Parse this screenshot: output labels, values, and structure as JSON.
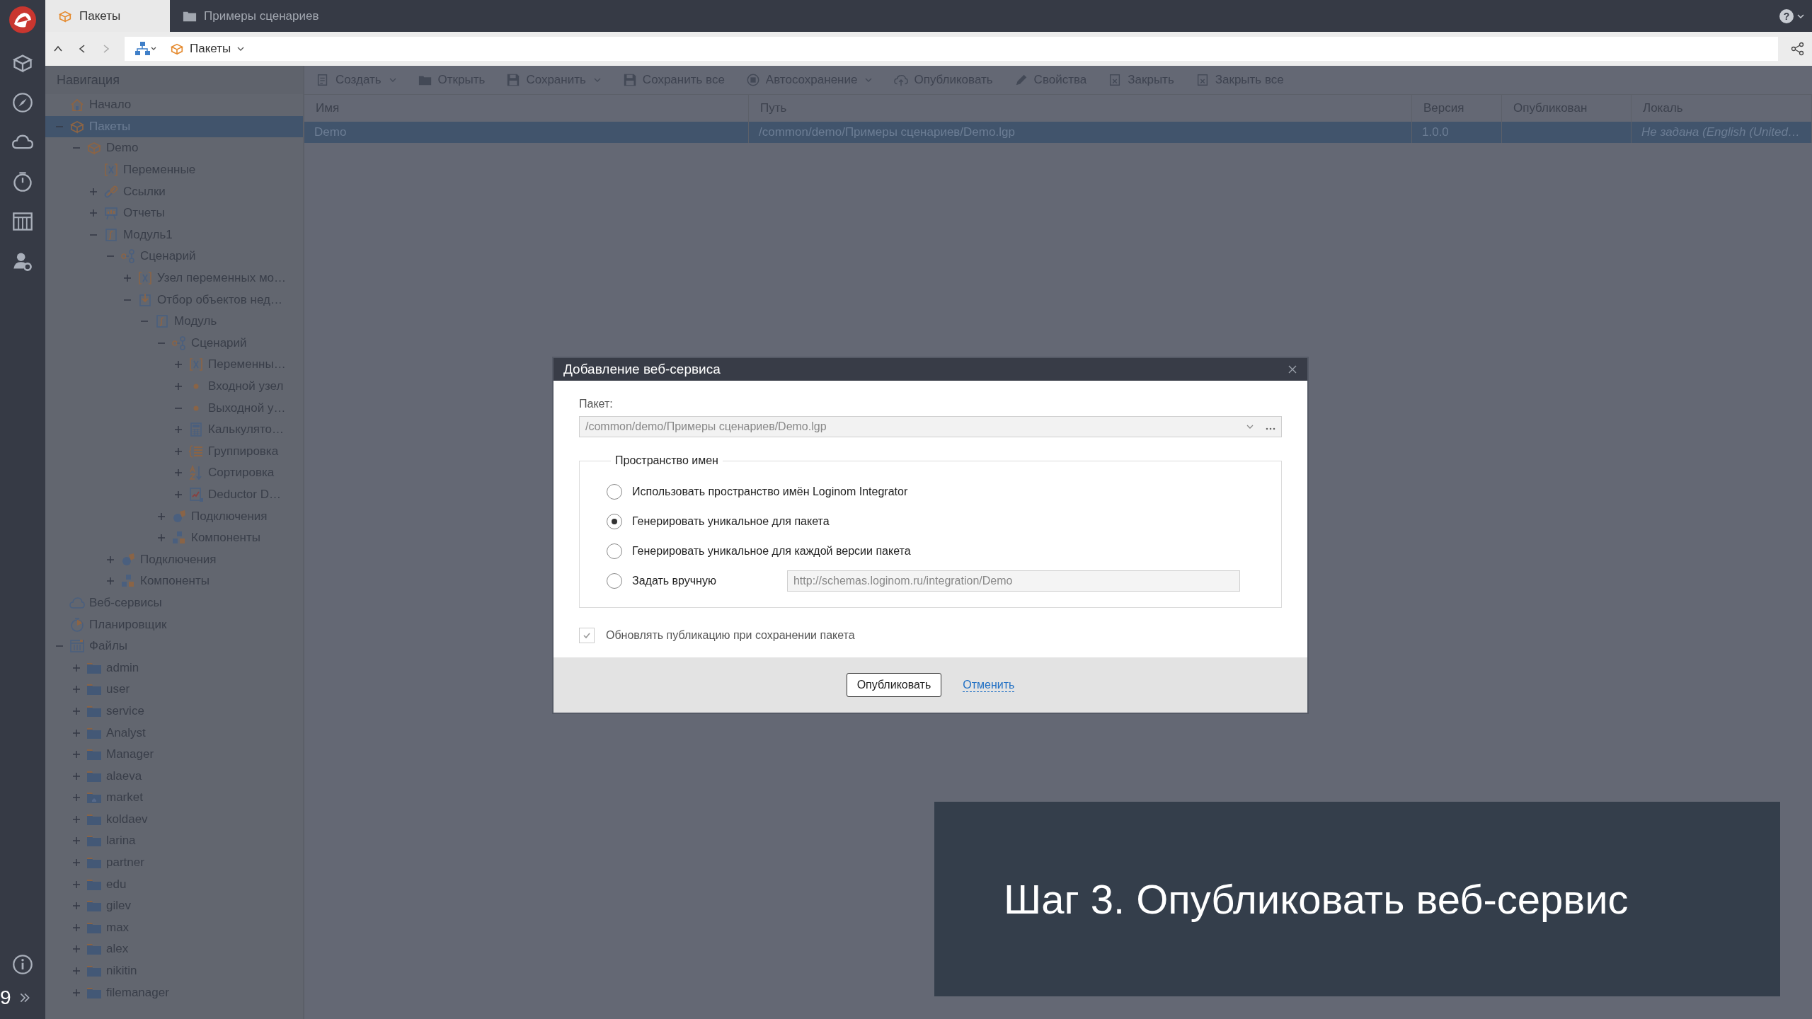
{
  "app_bar": {
    "page_number": "9",
    "help_label": "?"
  },
  "tabs": [
    {
      "label": "Пакеты",
      "kind": "package",
      "selected": true
    },
    {
      "label": "Примеры сценариев",
      "kind": "folder",
      "selected": false
    }
  ],
  "address_bar": {
    "crumb": "Пакеты"
  },
  "navigation": {
    "title": "Навигация",
    "tree": [
      {
        "label": "Начало",
        "kind": "home",
        "selected": false
      },
      {
        "label": "Пакеты",
        "kind": "package",
        "selected": true,
        "expanded": true,
        "children": [
          {
            "label": "Demo",
            "kind": "package",
            "selected": false,
            "expanded": true,
            "children": [
              {
                "label": "Переменные",
                "kind": "variables",
                "selected": false
              },
              {
                "label": "Ссылки",
                "kind": "link",
                "selected": false,
                "expanded": false
              },
              {
                "label": "Отчеты",
                "kind": "report",
                "selected": false,
                "expanded": false
              },
              {
                "label": "Модуль1",
                "kind": "module",
                "selected": false,
                "expanded": true,
                "children": [
                  {
                    "label": "Сценарий",
                    "kind": "scenario",
                    "selected": false,
                    "expanded": true,
                    "children": [
                      {
                        "label": "Узел переменных мо…",
                        "kind": "variables",
                        "selected": false,
                        "expanded": false
                      },
                      {
                        "label": "Отбор объектов нед…",
                        "kind": "import",
                        "selected": false,
                        "expanded": true,
                        "children": [
                          {
                            "label": "Модуль",
                            "kind": "module",
                            "selected": false,
                            "expanded": true,
                            "children": [
                              {
                                "label": "Сценарий",
                                "kind": "scenario",
                                "selected": false,
                                "expanded": true,
                                "children": [
                                  {
                                    "label": "Переменны…",
                                    "kind": "variables",
                                    "selected": false,
                                    "expanded": false
                                  },
                                  {
                                    "label": "Входной узел",
                                    "kind": "dot",
                                    "selected": false,
                                    "expanded": false
                                  },
                                  {
                                    "label": "Выходной у…",
                                    "kind": "dot",
                                    "selected": false,
                                    "expanded": true
                                  },
                                  {
                                    "label": "Калькулято…",
                                    "kind": "calc",
                                    "selected": false,
                                    "expanded": false
                                  },
                                  {
                                    "label": "Группировка",
                                    "kind": "group",
                                    "selected": false,
                                    "expanded": false
                                  },
                                  {
                                    "label": "Сортировка",
                                    "kind": "sort",
                                    "selected": false,
                                    "expanded": false
                                  },
                                  {
                                    "label": "Deductor D…",
                                    "kind": "deductor",
                                    "selected": false,
                                    "expanded": false
                                  }
                                ]
                              },
                              {
                                "label": "Подключения",
                                "kind": "connection",
                                "selected": false,
                                "expanded": false
                              },
                              {
                                "label": "Компоненты",
                                "kind": "components",
                                "selected": false,
                                "expanded": false
                              }
                            ]
                          }
                        ]
                      }
                    ]
                  },
                  {
                    "label": "Подключения",
                    "kind": "connection",
                    "selected": false,
                    "expanded": false
                  },
                  {
                    "label": "Компоненты",
                    "kind": "components",
                    "selected": false,
                    "expanded": false
                  }
                ]
              }
            ]
          }
        ]
      },
      {
        "label": "Веб-сервисы",
        "kind": "cloud",
        "selected": false
      },
      {
        "label": "Планировщик",
        "kind": "timer",
        "selected": false
      },
      {
        "label": "Файлы",
        "kind": "files",
        "selected": false,
        "expanded": true,
        "children": [
          {
            "label": "admin",
            "kind": "folder",
            "selected": false,
            "expanded": false
          },
          {
            "label": "user",
            "kind": "folder",
            "selected": false,
            "expanded": false
          },
          {
            "label": "service",
            "kind": "folder",
            "selected": false,
            "expanded": false
          },
          {
            "label": "Analyst",
            "kind": "folder",
            "selected": false,
            "expanded": false
          },
          {
            "label": "Manager",
            "kind": "folder",
            "selected": false,
            "expanded": false
          },
          {
            "label": "alaeva",
            "kind": "folder",
            "selected": false,
            "expanded": false
          },
          {
            "label": "market",
            "kind": "home-folder",
            "selected": false,
            "expanded": false
          },
          {
            "label": "koldaev",
            "kind": "folder",
            "selected": false,
            "expanded": false
          },
          {
            "label": "larina",
            "kind": "folder",
            "selected": false,
            "expanded": false
          },
          {
            "label": "partner",
            "kind": "folder",
            "selected": false,
            "expanded": false
          },
          {
            "label": "edu",
            "kind": "folder",
            "selected": false,
            "expanded": false
          },
          {
            "label": "gilev",
            "kind": "folder",
            "selected": false,
            "expanded": false
          },
          {
            "label": "max",
            "kind": "folder",
            "selected": false,
            "expanded": false
          },
          {
            "label": "alex",
            "kind": "folder",
            "selected": false,
            "expanded": false
          },
          {
            "label": "nikitin",
            "kind": "folder",
            "selected": false,
            "expanded": false
          },
          {
            "label": "filemanager",
            "kind": "folder",
            "selected": false,
            "expanded": false
          }
        ]
      }
    ]
  },
  "toolbar": [
    {
      "label": "Создать",
      "kind": "create",
      "dropdown": true
    },
    {
      "label": "Открыть",
      "kind": "open",
      "dropdown": false
    },
    {
      "label": "Сохранить",
      "kind": "save",
      "dropdown": true
    },
    {
      "label": "Сохранить все",
      "kind": "save",
      "dropdown": false
    },
    {
      "label": "Автосохранение",
      "kind": "autosave",
      "dropdown": true
    },
    {
      "label": "Опубликовать",
      "kind": "publish",
      "dropdown": false
    },
    {
      "label": "Свойства",
      "kind": "edit",
      "dropdown": false
    },
    {
      "label": "Закрыть",
      "kind": "close",
      "dropdown": false
    },
    {
      "label": "Закрыть все",
      "kind": "close",
      "dropdown": false
    }
  ],
  "table": {
    "columns": [
      "Имя",
      "Путь",
      "Версия",
      "Опубликован",
      "Локаль"
    ],
    "rows": [
      {
        "selected": true,
        "cells": [
          "Demo",
          "/common/demo/Примеры сценариев/Demo.lgp",
          "1.0.0",
          null,
          "Не задана (English (United…"
        ]
      }
    ]
  },
  "dialog": {
    "title": "Добавление веб-сервиса",
    "package_label": "Пакет:",
    "package_value": "/common/demo/Примеры сценариев/Demo.lgp",
    "namespace_title": "Пространство имен",
    "options": [
      {
        "label": "Использовать пространство имён Loginom Integrator",
        "selected": false
      },
      {
        "label": "Генерировать уникальное для пакета",
        "selected": true
      },
      {
        "label": "Генерировать уникальное для каждой версии пакета",
        "selected": false
      },
      {
        "label": "Задать вручную",
        "selected": false
      }
    ],
    "manual_value": "http://schemas.loginom.ru/integration/Demo",
    "update_checkbox": {
      "label": "Обновлять публикацию при сохранении пакета",
      "checked": true
    },
    "publish_button": "Опубликовать",
    "cancel_link": "Отменить"
  },
  "caption": "Шаг 3. Опубликовать веб-сервис"
}
